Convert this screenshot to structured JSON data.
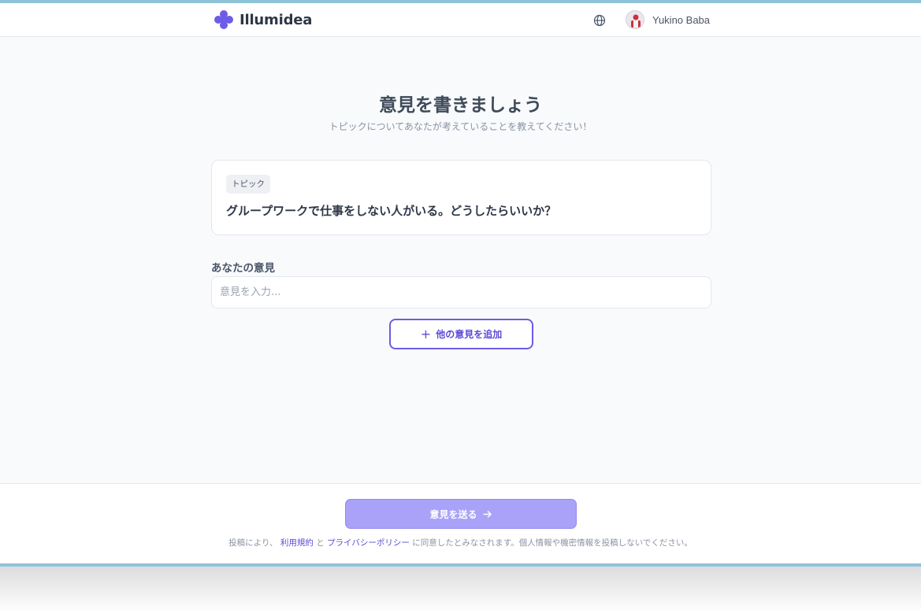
{
  "app": {
    "name": "Illumidea",
    "brand_color": "#6c5ce7"
  },
  "header": {
    "language_icon": "globe-icon",
    "user_name": "Yukino Baba"
  },
  "main": {
    "title": "意見を書きましょう",
    "subtitle": "トピックについてあなたが考えていることを教えてください！",
    "topic": {
      "badge": "トピック",
      "text": "グループワークで仕事をしない人がいる。どうしたらいいか？"
    },
    "opinion": {
      "label": "あなたの意見",
      "value": "",
      "placeholder": "意見を入力..."
    },
    "add_button": {
      "icon": "plus-icon",
      "label": "他の意見を追加"
    }
  },
  "footer": {
    "submit_label": "意見を送る",
    "submit_icon": "arrow-right-icon",
    "submit_color": "#a9a2f8",
    "terms": {
      "prefix": "投稿により、",
      "link1": "利用規約",
      "middle": "と",
      "link2": "プライバシーポリシー",
      "suffix": "に同意したとみなされます。個人情報や機密情報を投稿しないでください。"
    }
  }
}
